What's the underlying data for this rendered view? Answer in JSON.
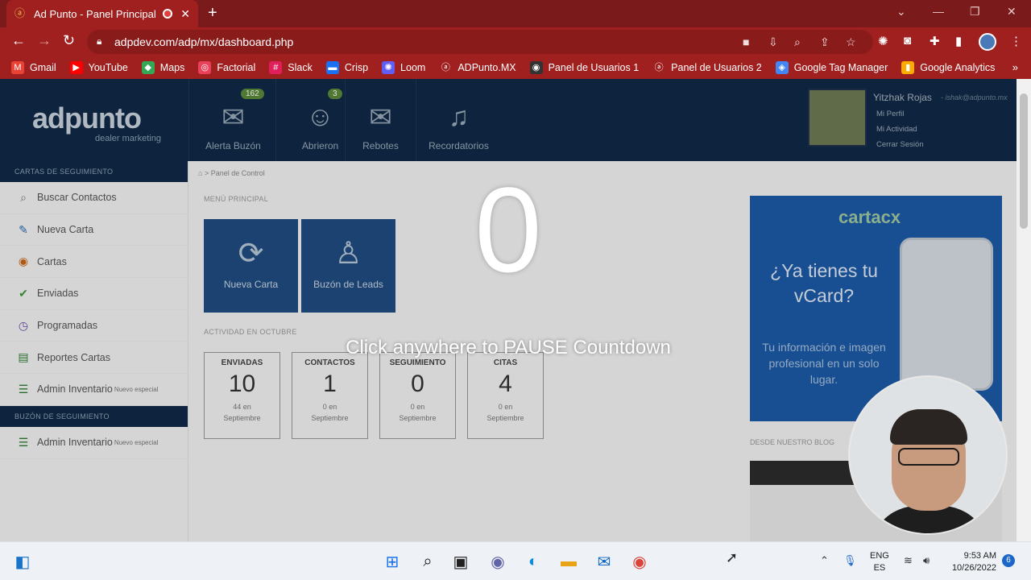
{
  "browser": {
    "tab_title": "Ad Punto - Panel Principal",
    "new_tab": "+",
    "url": "adpdev.com/adp/mx/dashboard.php",
    "bookmarks": [
      {
        "label": "Gmail",
        "icon": "gmail-icon",
        "color": "#ea4335",
        "glyph": "M"
      },
      {
        "label": "YouTube",
        "icon": "youtube-icon",
        "color": "#ff0000",
        "glyph": "▶"
      },
      {
        "label": "Maps",
        "icon": "maps-icon",
        "color": "#34a853",
        "glyph": "◆"
      },
      {
        "label": "Factorial",
        "icon": "factorial-icon",
        "color": "#e8415b",
        "glyph": "◎"
      },
      {
        "label": "Slack",
        "icon": "slack-icon",
        "color": "#e01e5a",
        "glyph": "#"
      },
      {
        "label": "Crisp",
        "icon": "crisp-icon",
        "color": "#1972f5",
        "glyph": "▬"
      },
      {
        "label": "Loom",
        "icon": "loom-icon",
        "color": "#625df5",
        "glyph": "✺"
      },
      {
        "label": "ADPunto.MX",
        "icon": "adpunto-icon",
        "color": "#a01f1f",
        "glyph": "ⓐ"
      },
      {
        "label": "Panel de Usuarios 1",
        "icon": "globe-icon",
        "color": "#333333",
        "glyph": "◉"
      },
      {
        "label": "Panel de Usuarios 2",
        "icon": "adpunto-icon",
        "color": "#a01f1f",
        "glyph": "ⓐ"
      },
      {
        "label": "Google Tag Manager",
        "icon": "tag-manager-icon",
        "color": "#4285f4",
        "glyph": "◈"
      },
      {
        "label": "Google Analytics",
        "icon": "analytics-icon",
        "color": "#f9ab00",
        "glyph": "▮"
      }
    ]
  },
  "header": {
    "logo": "adpunto",
    "logo_sub": "dealer marketing",
    "nav": [
      {
        "label": "Alerta Buzón",
        "badge": "162",
        "icon": "envelope-icon"
      },
      {
        "label": "Abrieron",
        "badge": "3",
        "icon": "users-icon"
      },
      {
        "label": "Rebotes",
        "badge": "",
        "icon": "envelope-x-icon"
      },
      {
        "label": "Recordatorios",
        "badge": "",
        "icon": "bell-icon"
      }
    ],
    "user": {
      "name": "Yitzhak Rojas",
      "email": "- ishak@adpunto.mx",
      "menu": [
        "Mi Perfil",
        "Mi Actividad",
        "Cerrar Sesión"
      ]
    }
  },
  "sidebar": {
    "section1": "CARTAS DE SEGUIMIENTO",
    "items1": [
      {
        "label": "Buscar Contactos",
        "icon": "search-icon",
        "glyph": "⌕",
        "color": "#777777",
        "sup": ""
      },
      {
        "label": "Nueva Carta",
        "icon": "pencil-icon",
        "glyph": "✎",
        "color": "#2e6bb5",
        "sup": ""
      },
      {
        "label": "Cartas",
        "icon": "eye-icon",
        "glyph": "◉",
        "color": "#c86418",
        "sup": ""
      },
      {
        "label": "Enviadas",
        "icon": "check-circle-icon",
        "glyph": "✔",
        "color": "#3b9b3b",
        "sup": ""
      },
      {
        "label": "Programadas",
        "icon": "clock-icon",
        "glyph": "◷",
        "color": "#6a4aa8",
        "sup": ""
      },
      {
        "label": "Reportes Cartas",
        "icon": "bar-chart-icon",
        "glyph": "▤",
        "color": "#2e7d32",
        "sup": ""
      },
      {
        "label": "Admin Inventario",
        "icon": "list-icon",
        "glyph": "☰",
        "color": "#2e7d32",
        "sup": "Nuevo especial"
      }
    ],
    "section2": "BUZÓN DE SEGUIMIENTO",
    "items2": [
      {
        "label": "Admin Inventario",
        "icon": "list-icon",
        "glyph": "☰",
        "color": "#2e7d32",
        "sup": "Nuevo especial"
      }
    ]
  },
  "main": {
    "breadcrumb": "Panel de Control",
    "menu_title": "MENÚ PRINCIPAL",
    "tiles": [
      {
        "label": "Nueva Carta",
        "icon": "new-letter-icon"
      },
      {
        "label": "Buzón de Leads",
        "icon": "user-check-icon"
      }
    ],
    "activity_title": "ACTIVIDAD EN OCTUBRE",
    "stats": [
      {
        "title": "ENVIADAS",
        "value": "10",
        "sub1": "44 en",
        "sub2": "Septiembre"
      },
      {
        "title": "CONTACTOS",
        "value": "1",
        "sub1": "0 en",
        "sub2": "Septiembre"
      },
      {
        "title": "SEGUIMIENTO",
        "value": "0",
        "sub1": "0 en",
        "sub2": "Septiembre"
      },
      {
        "title": "CITAS",
        "value": "4",
        "sub1": "0 en",
        "sub2": "Septiembre"
      }
    ],
    "ad": {
      "brand": "cartacx",
      "headline": "¿Ya tienes tu vCard?",
      "copy": "Tu información e imagen profesional en un solo lugar."
    },
    "blog_title": "DESDE NUESTRO BLOG"
  },
  "overlay": {
    "countdown": "0",
    "message": "Click anywhere to PAUSE Countdown"
  },
  "taskbar": {
    "lang1": "ENG",
    "lang2": "ES",
    "time": "9:53 AM",
    "date": "10/26/2022",
    "notifications": "6"
  }
}
